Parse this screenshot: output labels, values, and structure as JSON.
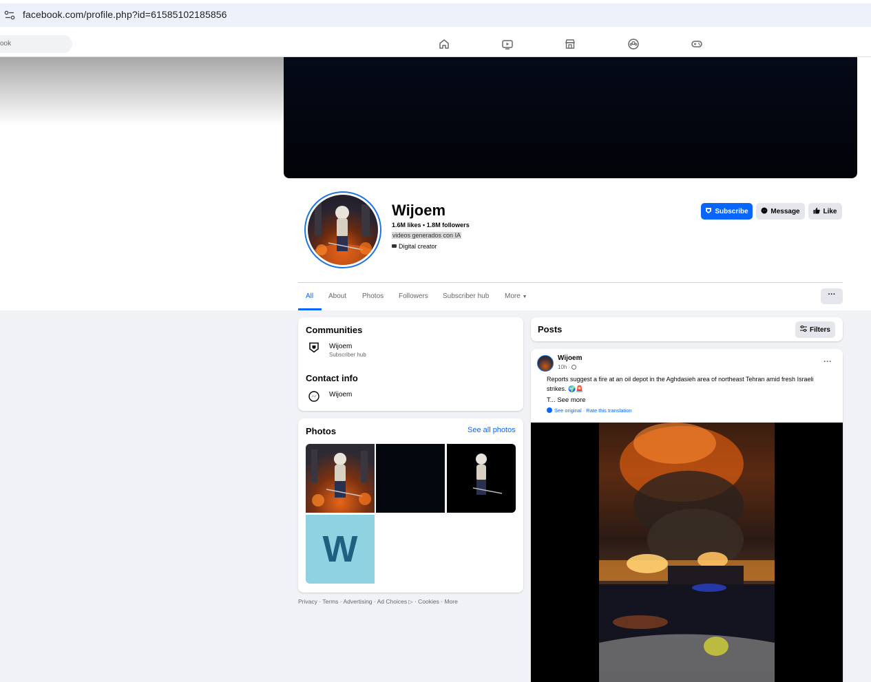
{
  "browser": {
    "url": "facebook.com/profile.php?id=61585102185856"
  },
  "nav": {
    "search_text": "ook",
    "icons": [
      "home-icon",
      "video-icon",
      "marketplace-icon",
      "groups-icon",
      "gaming-icon"
    ]
  },
  "profile": {
    "name": "Wijoem",
    "stats": "1.6M likes • 1.8M followers",
    "bio": "videos generados con IA",
    "category": "Digital creator",
    "buttons": {
      "subscribe": "Subscribe",
      "message": "Message",
      "like": "Like"
    }
  },
  "tabs": [
    "All",
    "About",
    "Photos",
    "Followers",
    "Subscriber hub",
    "More"
  ],
  "tab_more_button": "···",
  "communities": {
    "title": "Communities",
    "item_name": "Wijoem",
    "item_sub": "Subscriber hub"
  },
  "contact": {
    "title": "Contact info",
    "messenger": "Wijoem"
  },
  "photos": {
    "title": "Photos",
    "see_all": "See all photos",
    "placeholder_letter": "W"
  },
  "footer": {
    "text": "Privacy · Terms · Advertising · Ad Choices",
    "text2": " · Cookies · More"
  },
  "posts": {
    "title": "Posts",
    "filters": "Filters"
  },
  "post": {
    "author": "Wijoem",
    "time": "10h ·",
    "text": "Reports suggest a fire at an oil depot in the Aghdasieh area of northeast Tehran amid fresh Israeli strikes. 🌍🚨",
    "truncated": "T...",
    "see_more": "See more",
    "see_original": "See original",
    "rate_translation": "Rate this translation",
    "menu": "···"
  },
  "colors": {
    "accent": "#0866ff",
    "page_bg": "#f0f2f5"
  }
}
